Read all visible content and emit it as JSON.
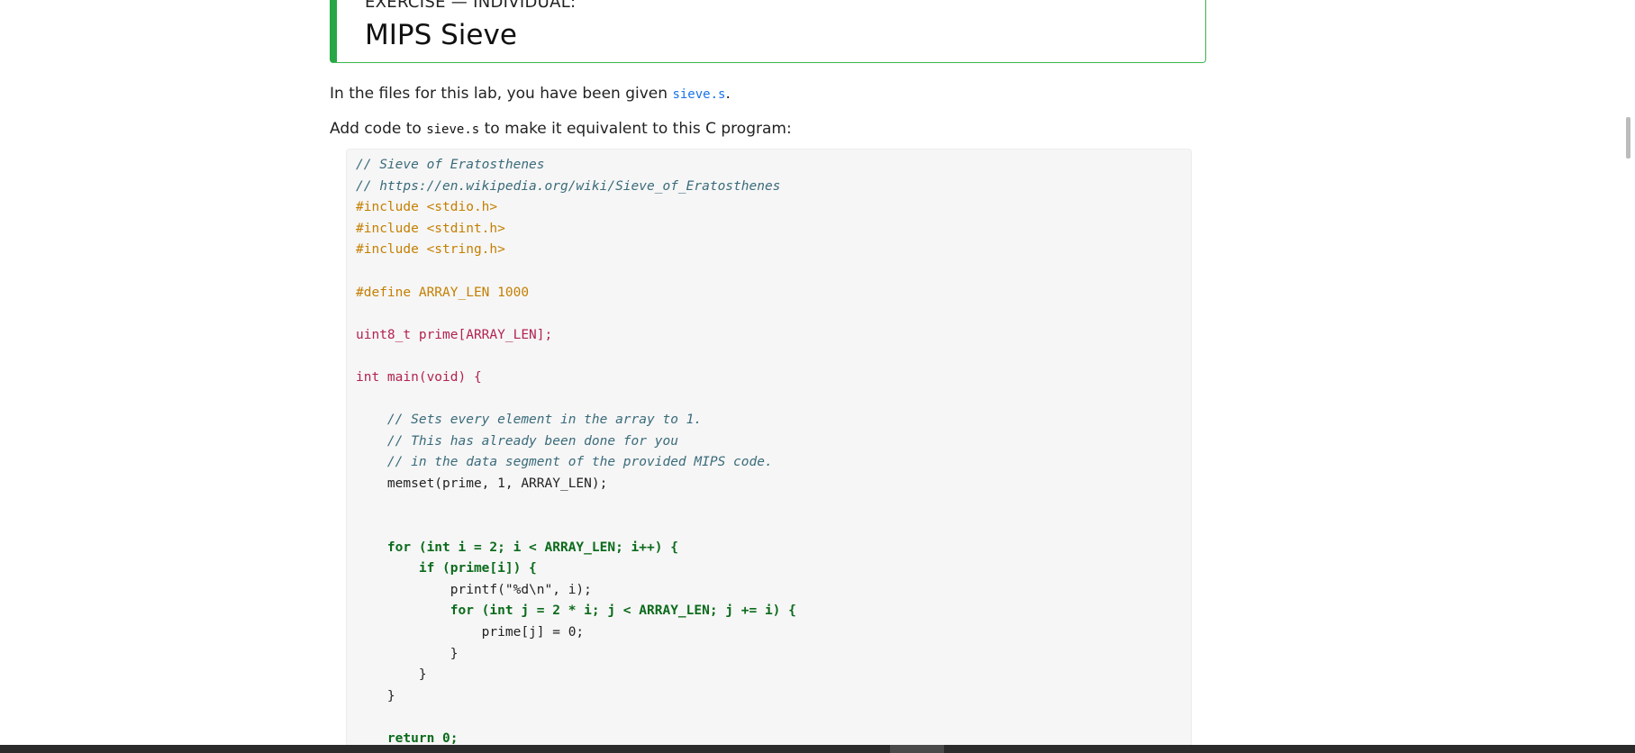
{
  "exercise": {
    "label": "EXERCISE — INDIVIDUAL:",
    "title": "MIPS Sieve"
  },
  "intro": {
    "prefix": "In the files for this lab, you have been given ",
    "file_link": "sieve.s",
    "suffix": "."
  },
  "instruction": {
    "prefix": "Add code to ",
    "file": "sieve.s",
    "suffix": " to make it equivalent to this C program:"
  },
  "code_lines": [
    "// Sieve of Eratosthenes",
    "// https://en.wikipedia.org/wiki/Sieve_of_Eratosthenes",
    "#include <stdio.h>",
    "#include <stdint.h>",
    "#include <string.h>",
    "",
    "#define ARRAY_LEN 1000",
    "",
    "uint8_t prime[ARRAY_LEN];",
    "",
    "int main(void) {",
    "",
    "    // Sets every element in the array to 1.",
    "    // This has already been done for you",
    "    // in the data segment of the provided MIPS code.",
    "    memset(prime, 1, ARRAY_LEN);",
    "",
    "",
    "    for (int i = 2; i < ARRAY_LEN; i++) {",
    "        if (prime[i]) {",
    "            printf(\"%d\\n\", i);",
    "            for (int j = 2 * i; j < ARRAY_LEN; j += i) {",
    "                prime[j] = 0;",
    "            }",
    "        }",
    "    }",
    "",
    "    return 0;"
  ],
  "colors": {
    "exercise_accent": "#28a745",
    "link": "#1a73e8",
    "comment": "#3a6b7a",
    "preprocessor": "#c47f00",
    "type": "#b2234f",
    "function": "#1f3fcf",
    "keyword": "#0b6b1b",
    "string": "#c12f2f"
  }
}
